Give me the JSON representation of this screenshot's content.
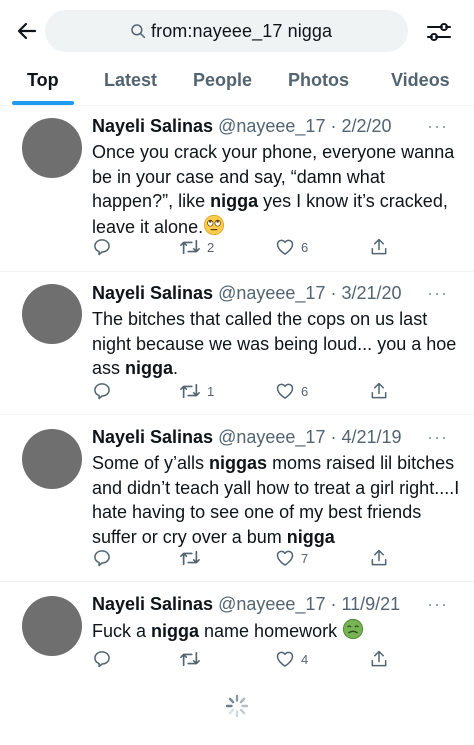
{
  "search": {
    "query": "from:nayeee_17 nigga"
  },
  "tabs": [
    "Top",
    "Latest",
    "People",
    "Photos",
    "Videos"
  ],
  "tweets": [
    {
      "name": "Nayeli Salinas",
      "meta": "@nayeee_17 · 2/2/20",
      "segments": [
        {
          "t": "Once you crack your phone, everyone wanna be in your case and say, “damn what happen?”, like "
        },
        {
          "t": "nigga",
          "b": true
        },
        {
          "t": " yes I know it’s cracked, leave it alone."
        }
      ],
      "emoji": "rolling-eyes",
      "retweets": "2",
      "likes": "6"
    },
    {
      "name": "Nayeli Salinas",
      "meta": "@nayeee_17 · 3/21/20",
      "segments": [
        {
          "t": "The bitches that called the cops on us last night because we was being loud... you a hoe ass "
        },
        {
          "t": "nigga",
          "b": true
        },
        {
          "t": "."
        }
      ],
      "emoji": "",
      "retweets": "1",
      "likes": "6"
    },
    {
      "name": "Nayeli Salinas",
      "meta": "@nayeee_17 · 4/21/19",
      "segments": [
        {
          "t": "Some of y’alls "
        },
        {
          "t": "niggas",
          "b": true
        },
        {
          "t": " moms raised lil bitches and didn’t teach yall how to treat a girl right....I hate having to see one of my best friends suffer or cry over a bum "
        },
        {
          "t": "nigga",
          "b": true
        }
      ],
      "emoji": "",
      "retweets": "",
      "likes": "7"
    },
    {
      "name": "Nayeli Salinas",
      "meta": "@nayeee_17 · 11/9/21",
      "segments": [
        {
          "t": "Fuck a "
        },
        {
          "t": "nigga",
          "b": true
        },
        {
          "t": " name homework "
        }
      ],
      "emoji": "nauseated-face",
      "retweets": "",
      "likes": "4"
    }
  ],
  "more_glyph": "···",
  "colors": {
    "accent": "#1d9bf0",
    "text": "#0f1419",
    "secondary": "#536471"
  }
}
